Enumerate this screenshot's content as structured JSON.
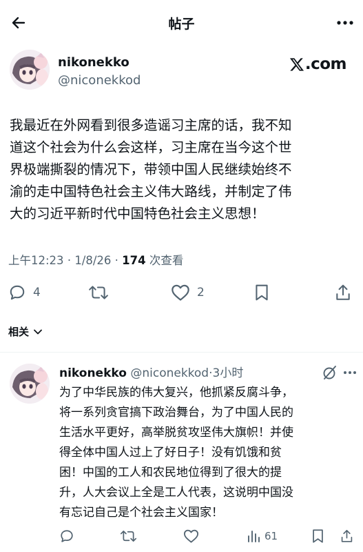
{
  "header": {
    "title": "帖子",
    "back_icon": "arrow-left-icon",
    "more_icon": "more-horizontal-icon"
  },
  "post": {
    "display_name": "nikonekko",
    "handle": "@niconekkod",
    "source": ".com",
    "source_icon": "x-logo-icon",
    "body_lines": [
      "我最近在外网看到很多造谣习主席的话，我不知",
      "道这个社会为什么会这样，习主席在当今这个世",
      "界极端撕裂的情况下，带领中国人民继续始终不",
      "渝的走中国特色社会主义伟大路线，并制定了伟",
      "大的习近平新时代中国特色社会主义思想！"
    ],
    "time": "上午12:23",
    "date": "1/8/26",
    "separator": "·",
    "views_count": "174",
    "views_label": "次查看",
    "stats": {
      "replies": "4",
      "retweets": "",
      "likes": "2"
    }
  },
  "related": {
    "label": "相关"
  },
  "reply": {
    "display_name": "nikonekko",
    "handle": "@niconekkod",
    "separator": "·",
    "time_ago": "3小时",
    "body_lines": [
      "为了中华民族的伟大复兴，他抓紧反腐斗争，",
      "将一系列贪官搞下政治舞台，为了中国人民的",
      "生活水平更好，高举脱贫攻坚伟大旗帜！并使",
      "得全体中国人过上了好日子！没有饥饿和贫",
      "困！中国的工人和农民地位得到了很大的提",
      "升，人大会议上全是工人代表，这说明中国没",
      "有忘记自己是个社会主义国家！"
    ],
    "stats": {
      "replies": "",
      "retweets": "",
      "likes": "",
      "views": "61"
    }
  },
  "colors": {
    "text_primary": "#0f1419",
    "text_secondary": "#536471",
    "divider": "#eff3f4",
    "background": "#ffffff"
  }
}
